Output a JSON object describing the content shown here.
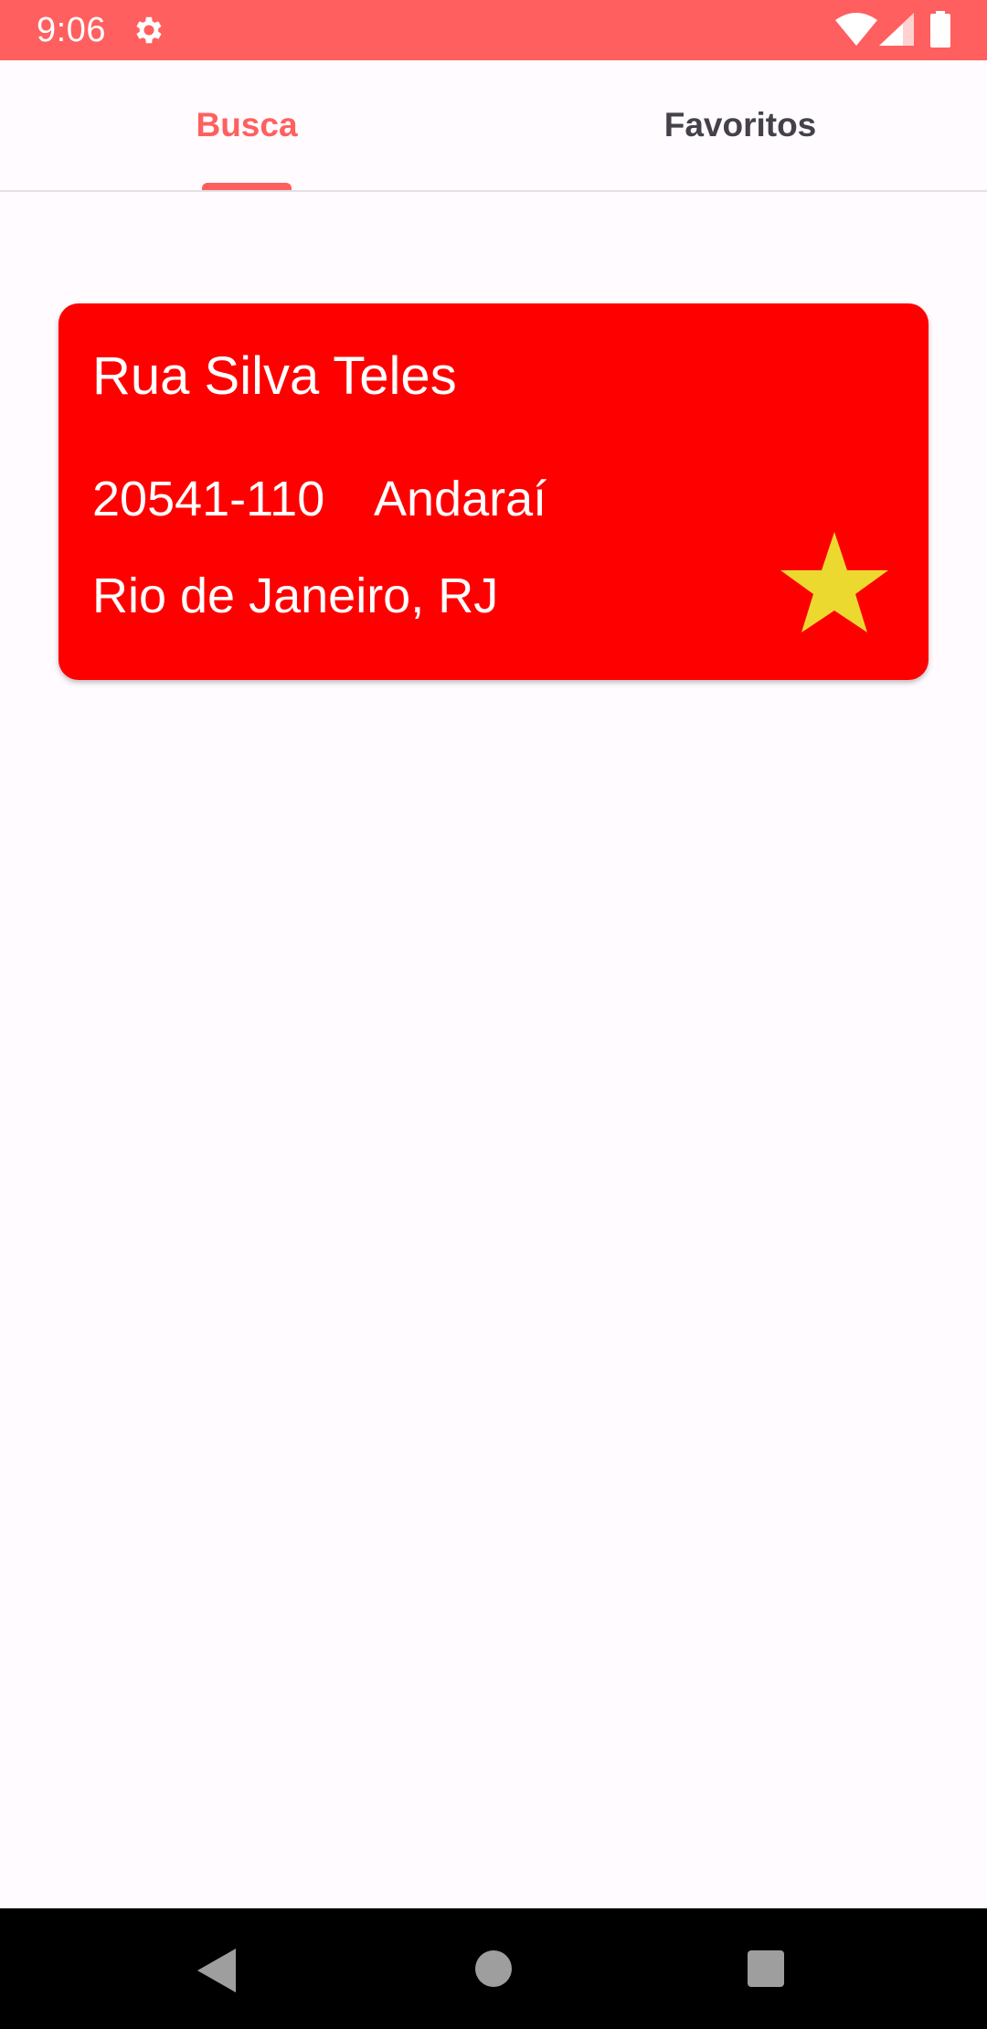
{
  "status_bar": {
    "time": "9:06",
    "background_color": "#ff5f5f",
    "icons": [
      "settings-icon",
      "wifi-icon",
      "signal-icon",
      "battery-icon"
    ]
  },
  "tabs": [
    {
      "label": "Busca",
      "active": true
    },
    {
      "label": "Favoritos",
      "active": false
    }
  ],
  "colors": {
    "accent": "#ff5f5f",
    "card_background": "#ff0000",
    "star": "#ecd930"
  },
  "address": {
    "street": "Rua Silva Teles",
    "cep": "20541-110",
    "bairro": "Andaraí",
    "cidade": "Rio de Janeiro, RJ",
    "favorite_icon": "star-icon"
  },
  "nav_bar": {
    "icons": [
      "back-icon",
      "home-icon",
      "recents-icon"
    ]
  }
}
